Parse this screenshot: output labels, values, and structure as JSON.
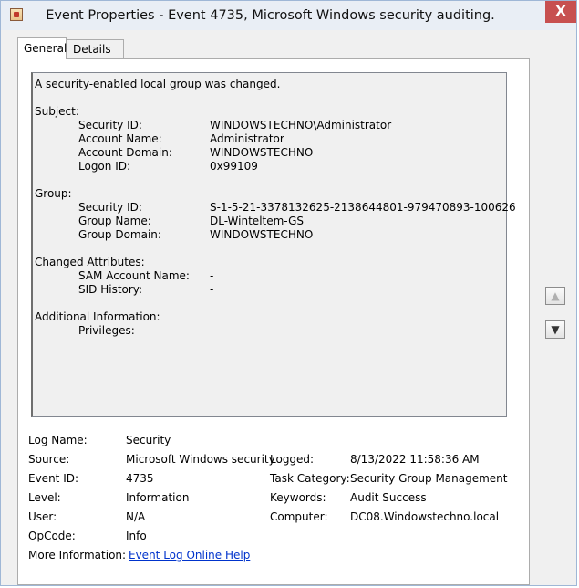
{
  "window": {
    "title": "Event Properties - Event 4735, Microsoft Windows security auditing.",
    "close_label": "X"
  },
  "tabs": [
    {
      "label": "General"
    },
    {
      "label": "Details"
    }
  ],
  "description": {
    "header": "A security-enabled local group was changed.",
    "subject_label": "Subject:",
    "subject": [
      {
        "label": "Security ID:",
        "value": "WINDOWSTECHNO\\Administrator"
      },
      {
        "label": "Account Name:",
        "value": "Administrator"
      },
      {
        "label": "Account Domain:",
        "value": "WINDOWSTECHNO"
      },
      {
        "label": "Logon ID:",
        "value": "0x99109"
      }
    ],
    "group_label": "Group:",
    "group": [
      {
        "label": "Security ID:",
        "value": "S-1-5-21-3378132625-2138644801-979470893-100626"
      },
      {
        "label": "Group Name:",
        "value": "DL-Winteltem-GS"
      },
      {
        "label": "Group Domain:",
        "value": "WINDOWSTECHNO"
      }
    ],
    "changed_label": "Changed Attributes:",
    "changed": [
      {
        "label": "SAM Account Name:",
        "value": "-"
      },
      {
        "label": "SID History:",
        "value": "-"
      }
    ],
    "additional_label": "Additional Information:",
    "additional": [
      {
        "label": "Privileges:",
        "value": "-"
      }
    ]
  },
  "details": {
    "log_name_label": "Log Name:",
    "log_name": "Security",
    "source_label": "Source:",
    "source": "Microsoft Windows security",
    "logged_label": "Logged:",
    "logged": "8/13/2022 11:58:36 AM",
    "event_id_label": "Event ID:",
    "event_id": "4735",
    "task_category_label": "Task Category:",
    "task_category": "Security Group Management",
    "level_label": "Level:",
    "level": "Information",
    "keywords_label": "Keywords:",
    "keywords": "Audit Success",
    "user_label": "User:",
    "user": "N/A",
    "computer_label": "Computer:",
    "computer": "DC08.Windowstechno.local",
    "opcode_label": "OpCode:",
    "opcode": "Info",
    "more_info_label": "More Information:",
    "more_info_link": "Event Log Online Help"
  },
  "nav": {
    "up_icon": "arrow-up-icon",
    "down_icon": "arrow-down-icon"
  }
}
